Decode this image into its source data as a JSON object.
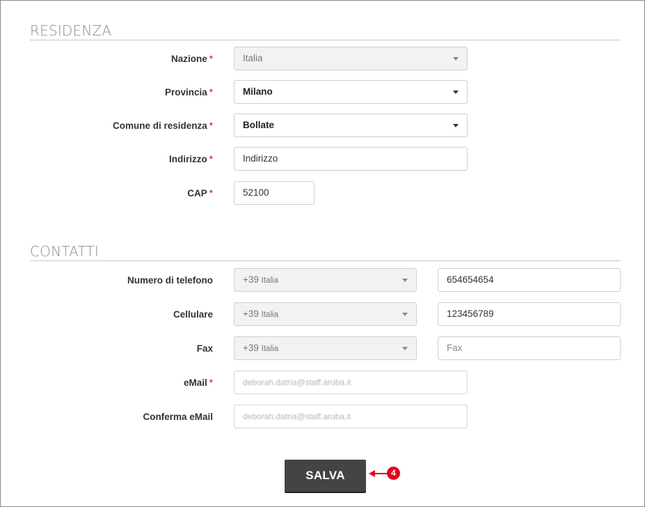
{
  "residenza": {
    "title": "RESIDENZA",
    "nazione": {
      "label": "Nazione",
      "value": "Italia"
    },
    "provincia": {
      "label": "Provincia",
      "value": "Milano"
    },
    "comune": {
      "label": "Comune di residenza",
      "value": "Bollate"
    },
    "indirizzo": {
      "label": "Indirizzo",
      "placeholder": "Indirizzo"
    },
    "cap": {
      "label": "CAP",
      "value": "52100"
    }
  },
  "contatti": {
    "title": "CONTATTI",
    "telefono": {
      "label": "Numero di telefono",
      "prefix": "+39",
      "country": "Italia",
      "value": "654654654"
    },
    "cellulare": {
      "label": "Cellulare",
      "prefix": "+39",
      "country": "Italia",
      "value": "123456789"
    },
    "fax": {
      "label": "Fax",
      "prefix": "+39",
      "country": "Italia",
      "placeholder": "Fax"
    },
    "email": {
      "label": "eMail",
      "value": "deborah.datria@staff.aruba.it"
    },
    "conferma_email": {
      "label": "Conferma eMail",
      "value": "deborah.datria@staff.aruba.it"
    }
  },
  "required_marker": "*",
  "actions": {
    "save_label": "SALVA",
    "callout_number": "4"
  },
  "colors": {
    "button_bg": "#444444",
    "required": "#d0021b",
    "callout": "#e2001a",
    "disabled_bg": "#f2f2f2"
  }
}
